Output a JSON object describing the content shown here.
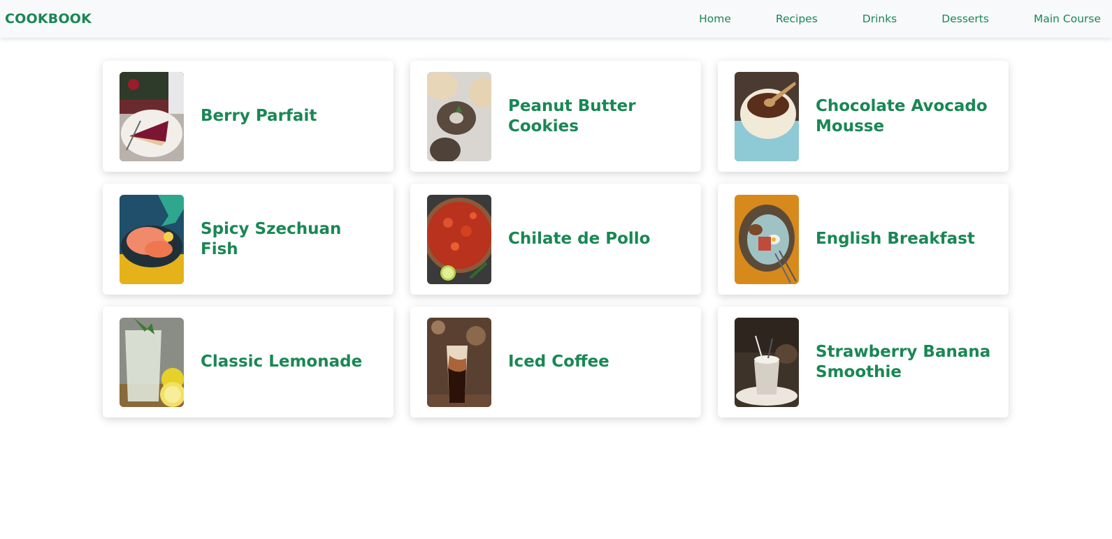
{
  "nav": {
    "brand": "COOKBOOK",
    "links": [
      "Home",
      "Recipes",
      "Drinks",
      "Desserts",
      "Main Course"
    ]
  },
  "recipes": [
    {
      "title": "Berry Parfait",
      "image": "berry-parfait-photo"
    },
    {
      "title": "Peanut Butter Cookies",
      "image": "peanut-butter-cookies-photo"
    },
    {
      "title": "Chocolate Avocado Mousse",
      "image": "chocolate-avocado-mousse-photo"
    },
    {
      "title": "Spicy Szechuan Fish",
      "image": "spicy-szechuan-fish-photo"
    },
    {
      "title": "Chilate de Pollo",
      "image": "chilate-de-pollo-photo"
    },
    {
      "title": "English Breakfast",
      "image": "english-breakfast-photo"
    },
    {
      "title": "Classic Lemonade",
      "image": "classic-lemonade-photo"
    },
    {
      "title": "Iced Coffee",
      "image": "iced-coffee-photo"
    },
    {
      "title": "Strawberry Banana Smoothie",
      "image": "strawberry-banana-smoothie-photo"
    }
  ],
  "colors": {
    "accent": "#198754",
    "navbar_bg": "#f8f9fa",
    "page_bg": "#ffffff"
  }
}
